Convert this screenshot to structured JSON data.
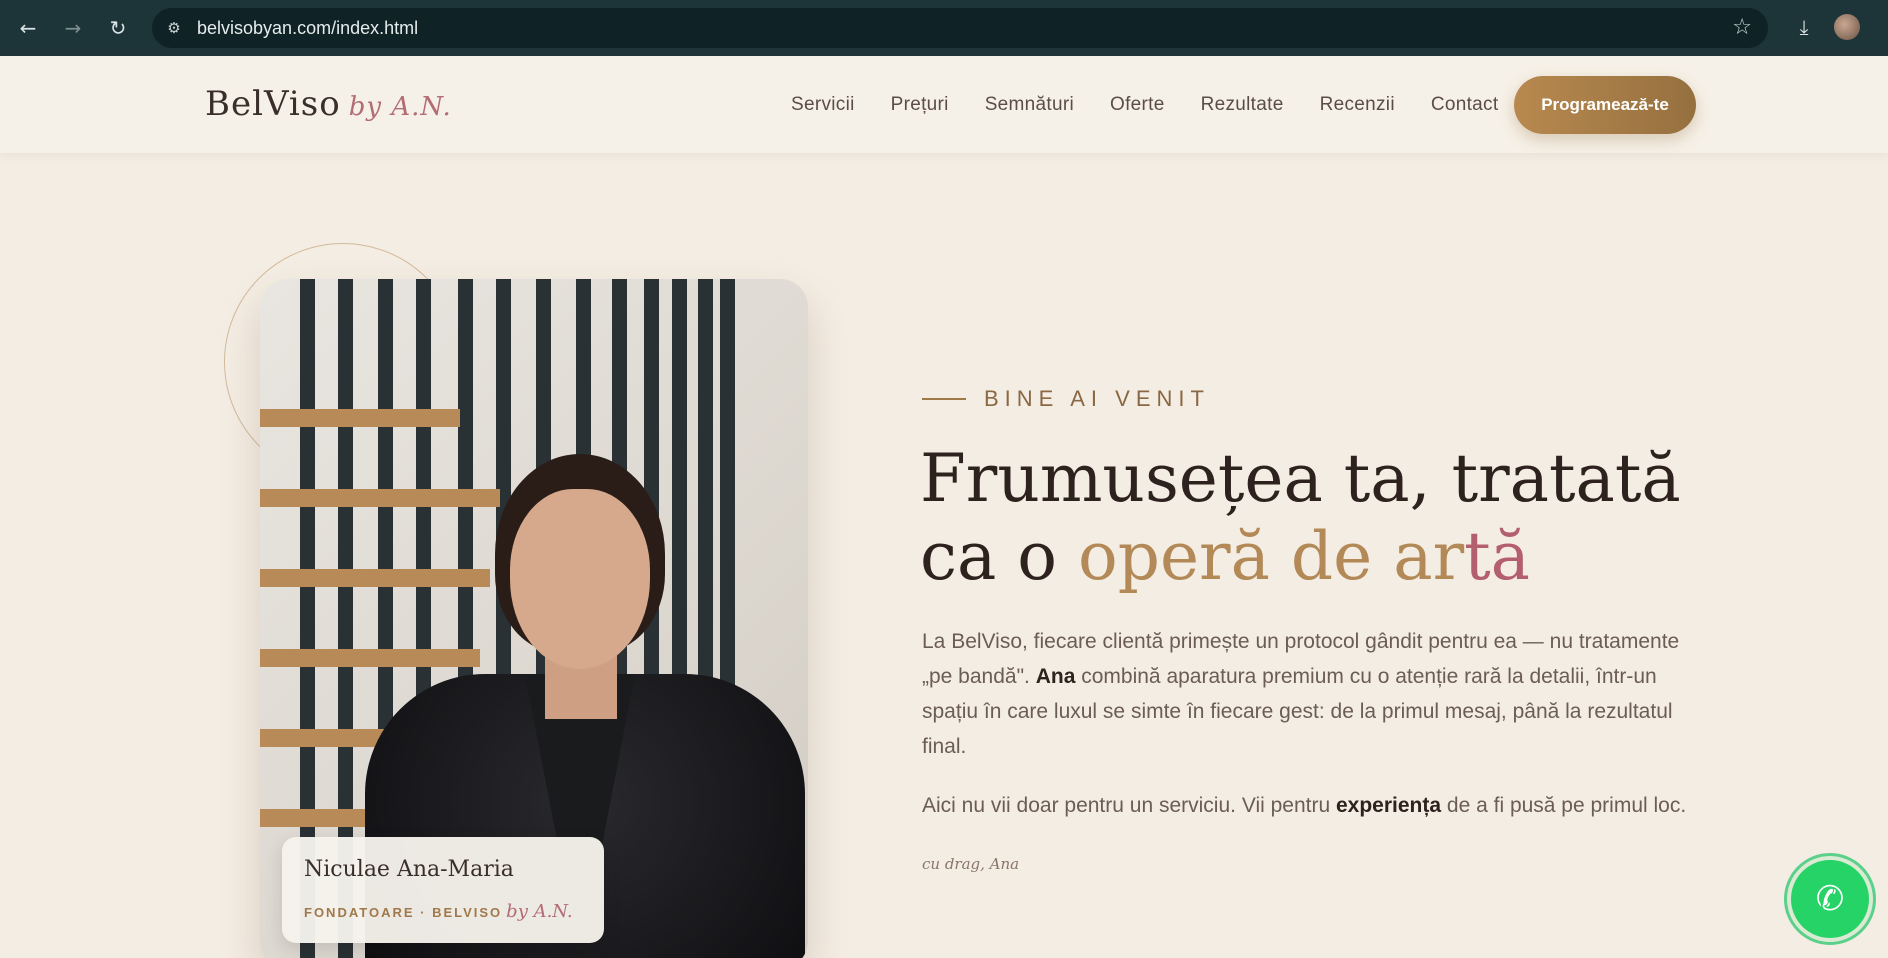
{
  "browser": {
    "url": "belvisobyan.com/index.html",
    "icons": [
      "back-arrow-icon",
      "forward-arrow-icon",
      "reload-icon",
      "site-settings-icon",
      "bookmark-star-icon",
      "download-icon",
      "profile-avatar"
    ]
  },
  "header": {
    "logo_main": "BelViso",
    "logo_by": "by A.N.",
    "menu": [
      "Servicii",
      "Prețuri",
      "Semnături",
      "Oferte",
      "Rezultate",
      "Recenzii",
      "Contact"
    ],
    "cta_label": "Programează-te"
  },
  "hero": {
    "eyebrow": "BINE AI VENIT",
    "headline": {
      "part1": "Frumusețea ta, tratată ca o ",
      "gold": "operă de ar",
      "rose": "tă"
    },
    "paragraph1": {
      "before": "La BelViso, fiecare clientă primește un protocol gândit pentru ea — nu tratamente „pe bandă\". ",
      "bold": "Ana",
      "after": " combină aparatura premium cu o atenție rară la detalii, într-un spațiu în care luxul se simte în fiecare gest: de la primul mesaj, până la rezultatul final."
    },
    "paragraph2": {
      "before": "Aici nu vii doar pentru un serviciu. Vii pentru ",
      "bold": "experiența",
      "after": " de a fi pusă pe primul loc."
    },
    "signature": "cu drag, Ana",
    "photo_caption": {
      "name": "Niculae Ana-Maria",
      "role": "FONDATOARE · BELVISO",
      "by": "by A.N."
    }
  },
  "colors": {
    "background": "#f4ede3",
    "accent_gold": "#b28957",
    "accent_rose": "#b35f6e",
    "cta_gradient_start": "#b8894f",
    "whatsapp_green": "#25d366"
  },
  "floating": {
    "whatsapp_icon": "whatsapp-icon"
  }
}
